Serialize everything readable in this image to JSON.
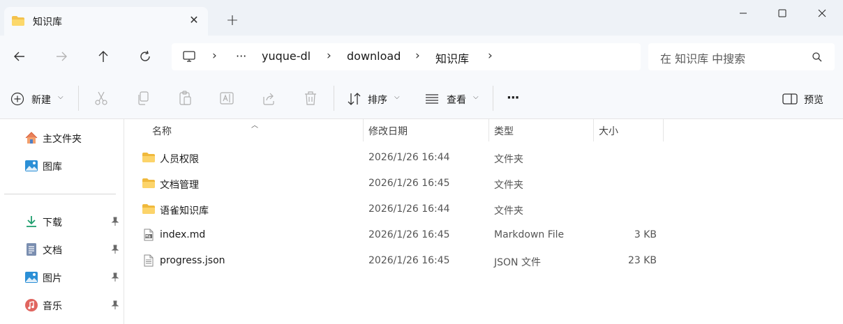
{
  "window": {
    "tab_title": "知识库",
    "new_tab_symbol": "+",
    "close_symbol": "✕"
  },
  "breadcrumb": {
    "ellipsis": "···",
    "items": [
      "yuque-dl",
      "download",
      "知识库"
    ]
  },
  "search": {
    "placeholder": "在 知识库 中搜索"
  },
  "toolbar": {
    "new_label": "新建",
    "sort_label": "排序",
    "view_label": "查看",
    "more_label": "···",
    "preview_label": "预览"
  },
  "sidebar": {
    "items": [
      {
        "label": "主文件夹",
        "icon": "home-icon"
      },
      {
        "label": "图库",
        "icon": "gallery-icon"
      },
      {
        "label": "下载",
        "icon": "download-icon",
        "pinned": true
      },
      {
        "label": "文档",
        "icon": "documents-icon",
        "pinned": true
      },
      {
        "label": "图片",
        "icon": "pictures-icon",
        "pinned": true
      },
      {
        "label": "音乐",
        "icon": "music-icon",
        "pinned": true
      }
    ]
  },
  "columns": {
    "name": "名称",
    "modified": "修改日期",
    "type": "类型",
    "size": "大小"
  },
  "files": [
    {
      "name": "人员权限",
      "modified": "2026/1/26 16:44",
      "type": "文件夹",
      "size": "",
      "icon": "folder-icon"
    },
    {
      "name": "文档管理",
      "modified": "2026/1/26 16:45",
      "type": "文件夹",
      "size": "",
      "icon": "folder-icon"
    },
    {
      "name": "语雀知识库",
      "modified": "2026/1/26 16:44",
      "type": "文件夹",
      "size": "",
      "icon": "folder-icon"
    },
    {
      "name": "index.md",
      "modified": "2026/1/26 16:45",
      "type": "Markdown File",
      "size": "3 KB",
      "icon": "markdown-file-icon"
    },
    {
      "name": "progress.json",
      "modified": "2026/1/26 16:45",
      "type": "JSON 文件",
      "size": "23 KB",
      "icon": "text-file-icon"
    }
  ],
  "colors": {
    "folder": "#f4c24d",
    "accent": "#0067c0",
    "chrome_bg": "#eef2f7"
  }
}
